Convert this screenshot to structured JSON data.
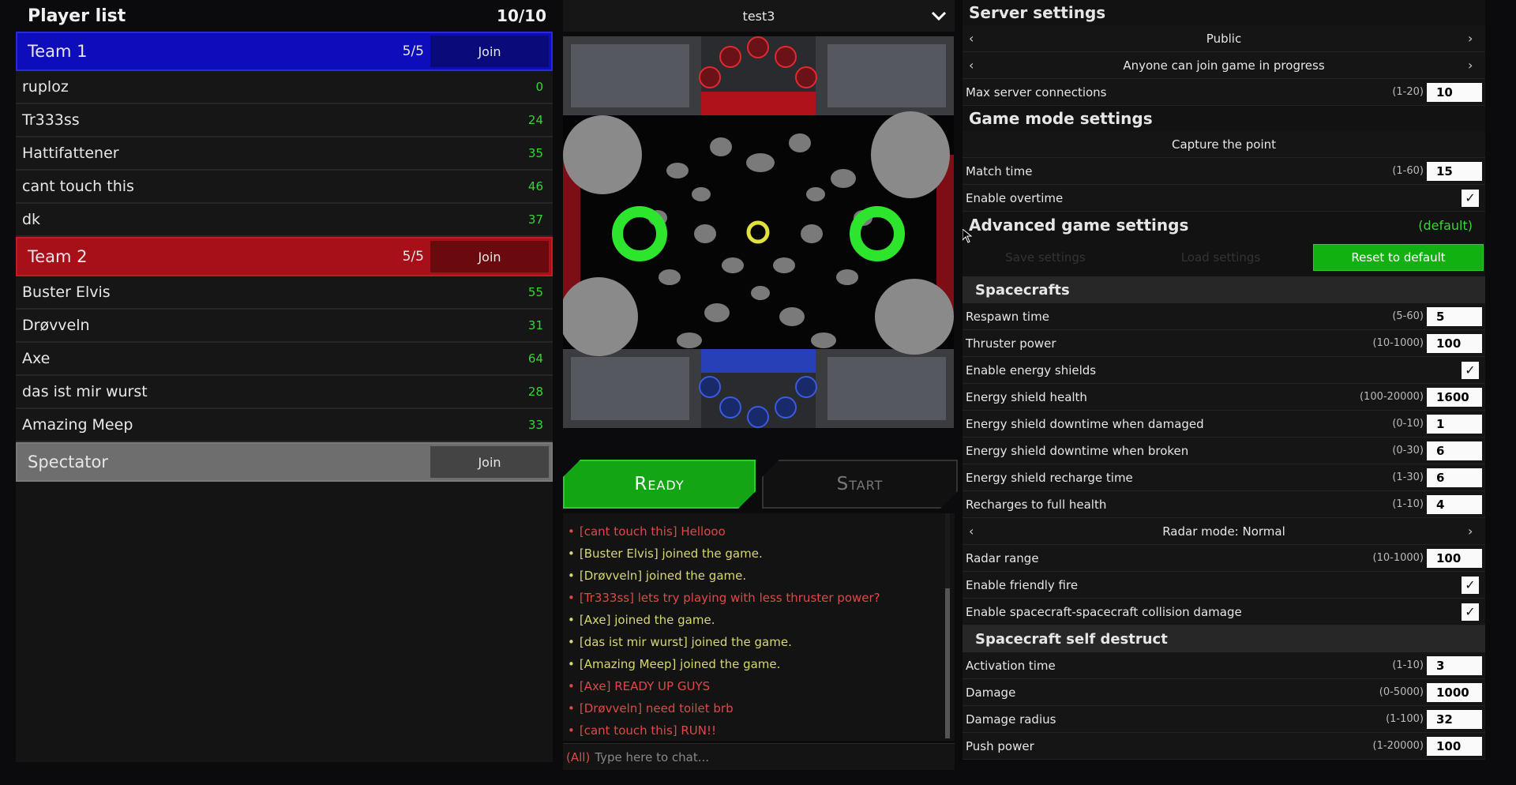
{
  "player_list": {
    "title": "Player list",
    "count": "10/10",
    "teams": [
      {
        "name": "Team 1",
        "count": "5/5",
        "join_label": "Join",
        "color": "#0d0dbb",
        "players": [
          {
            "name": "ruploz",
            "score": "0"
          },
          {
            "name": "Tr333ss",
            "score": "24"
          },
          {
            "name": "Hattifattener",
            "score": "35"
          },
          {
            "name": "cant touch this",
            "score": "46"
          },
          {
            "name": "dk",
            "score": "37"
          }
        ]
      },
      {
        "name": "Team 2",
        "count": "5/5",
        "join_label": "Join",
        "color": "#a70f19",
        "players": [
          {
            "name": "Buster Elvis",
            "score": "55"
          },
          {
            "name": "Drøvveln",
            "score": "31"
          },
          {
            "name": "Axe",
            "score": "64"
          },
          {
            "name": "das ist mir wurst",
            "score": "28"
          },
          {
            "name": "Amazing Meep",
            "score": "33"
          }
        ]
      }
    ],
    "spectator": {
      "name": "Spectator",
      "join_label": "Join"
    }
  },
  "map": {
    "name": "test3",
    "dropdown_icon": "chevron-down-icon"
  },
  "buttons": {
    "ready": "Ready",
    "start": "Start"
  },
  "chat": {
    "messages": [
      {
        "text": "[cant touch this] Hellooo",
        "kind": "red"
      },
      {
        "text": "[Buster Elvis] joined the game.",
        "kind": "yellow"
      },
      {
        "text": "[Drøvveln] joined the game.",
        "kind": "yellow"
      },
      {
        "text": "[Tr333ss] lets try playing with less thruster power?",
        "kind": "red"
      },
      {
        "text": "[Axe] joined the game.",
        "kind": "yellow"
      },
      {
        "text": "[das ist mir wurst] joined the game.",
        "kind": "yellow"
      },
      {
        "text": "[Amazing Meep] joined the game.",
        "kind": "yellow"
      },
      {
        "text": "[Axe] READY UP GUYS",
        "kind": "red"
      },
      {
        "text": "[Drøvveln] need toilet brb",
        "kind": "red"
      },
      {
        "text": "[cant touch this] RUN!!",
        "kind": "red"
      }
    ],
    "channel": "(All)",
    "placeholder": "Type here to chat..."
  },
  "settings": {
    "server_title": "Server settings",
    "visibility": "Public",
    "join_policy": "Anyone can join game in progress",
    "max_conn": {
      "label": "Max server connections",
      "range": "(1-20)",
      "value": "10"
    },
    "game_mode_title": "Game mode settings",
    "game_mode": "Capture the point",
    "match_time": {
      "label": "Match time",
      "range": "(1-60)",
      "value": "15"
    },
    "overtime": {
      "label": "Enable overtime",
      "checked": "✓"
    },
    "advanced_title": "Advanced game settings",
    "advanced_default": "(default)",
    "save_label": "Save settings",
    "load_label": "Load settings",
    "reset_label": "Reset to default",
    "spacecrafts_title": "Spacecrafts",
    "spacecraft_rows": [
      {
        "label": "Respawn time",
        "range": "(5-60)",
        "value": "5"
      },
      {
        "label": "Thruster power",
        "range": "(10-1000)",
        "value": "100"
      },
      {
        "label": "Enable energy shields",
        "checked": "✓"
      },
      {
        "label": "Energy shield health",
        "range": "(100-20000)",
        "value": "1600"
      },
      {
        "label": "Energy shield downtime when damaged",
        "range": "(0-10)",
        "value": "1"
      },
      {
        "label": "Energy shield downtime when broken",
        "range": "(0-30)",
        "value": "6"
      },
      {
        "label": "Energy shield recharge time",
        "range": "(1-30)",
        "value": "6"
      },
      {
        "label": "Recharges to full health",
        "range": "(1-10)",
        "value": "4"
      }
    ],
    "radar_mode": "Radar mode: Normal",
    "spacecraft_rows2": [
      {
        "label": "Radar range",
        "range": "(10-1000)",
        "value": "100"
      },
      {
        "label": "Enable friendly fire",
        "checked": "✓"
      },
      {
        "label": "Enable spacecraft-spacecraft collision damage",
        "checked": "✓"
      }
    ],
    "self_destruct_title": "Spacecraft self destruct",
    "self_destruct_rows": [
      {
        "label": "Activation time",
        "range": "(1-10)",
        "value": "3"
      },
      {
        "label": "Damage",
        "range": "(0-5000)",
        "value": "1000"
      },
      {
        "label": "Damage radius",
        "range": "(1-100)",
        "value": "32"
      },
      {
        "label": "Push power",
        "range": "(1-20000)",
        "value": "100"
      }
    ]
  }
}
